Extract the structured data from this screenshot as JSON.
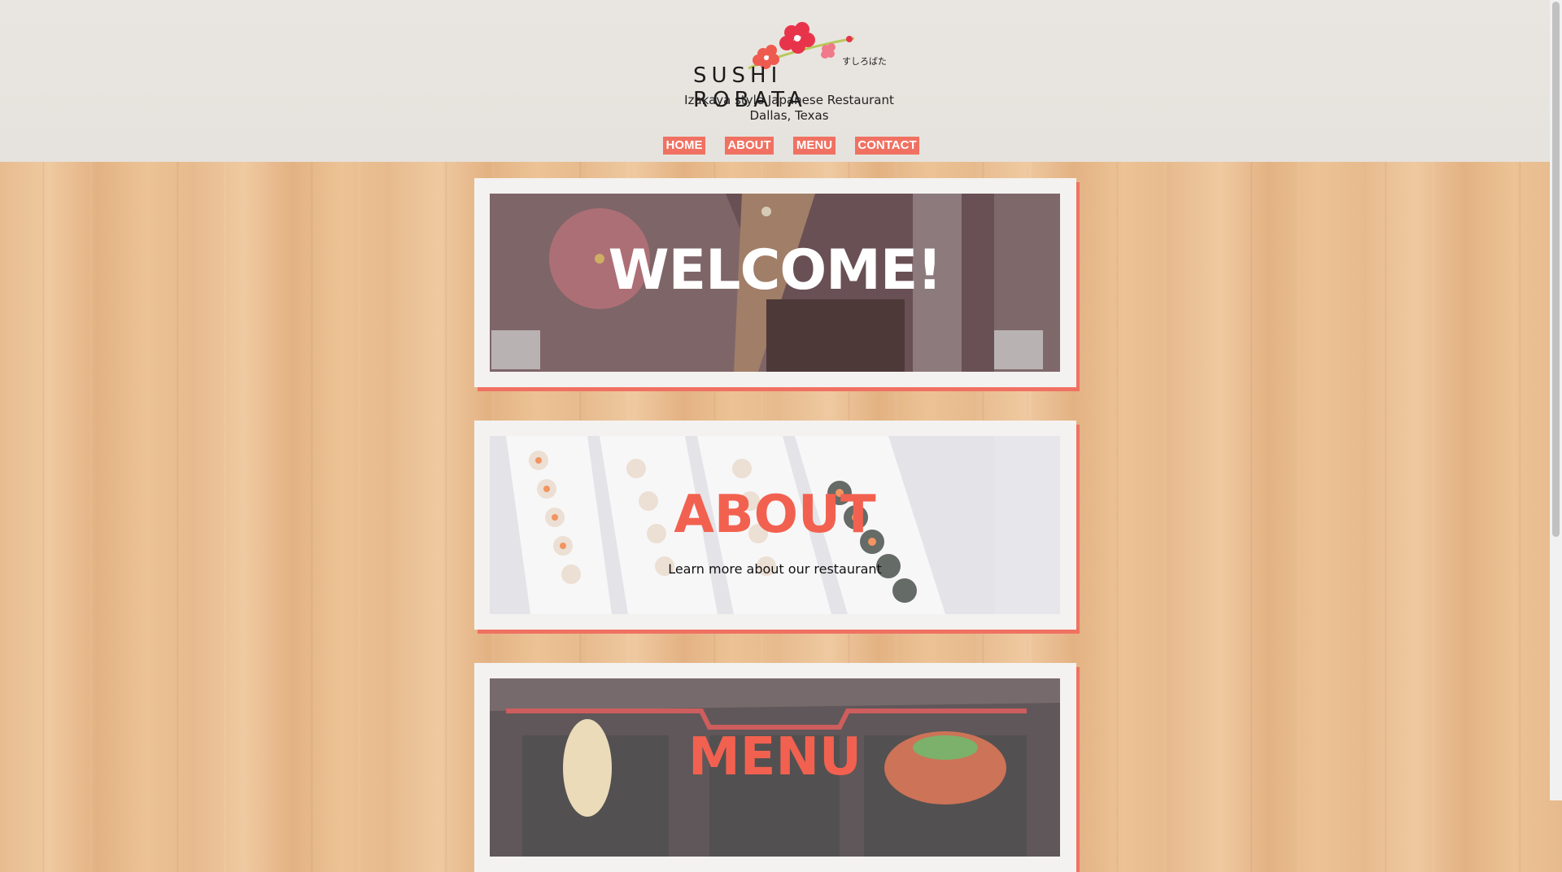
{
  "header": {
    "brand": "SUSHI ROBATA",
    "brand_kana": "すしろばた",
    "tagline_line1": "Izakaya style Japanese Restaurant",
    "tagline_line2": "Dallas, Texas"
  },
  "nav": {
    "items": [
      {
        "label": "HOME"
      },
      {
        "label": "ABOUT"
      },
      {
        "label": "MENU"
      },
      {
        "label": "CONTACT"
      }
    ]
  },
  "sections": {
    "welcome": {
      "title": "WELCOME!"
    },
    "about": {
      "title": "ABOUT",
      "subtitle": "Learn more about our restaurant"
    },
    "menu": {
      "title": "MENU"
    }
  },
  "colors": {
    "accent": "#f07162",
    "header_bg": "#e8e5e0",
    "wood": "#e9bf92"
  }
}
